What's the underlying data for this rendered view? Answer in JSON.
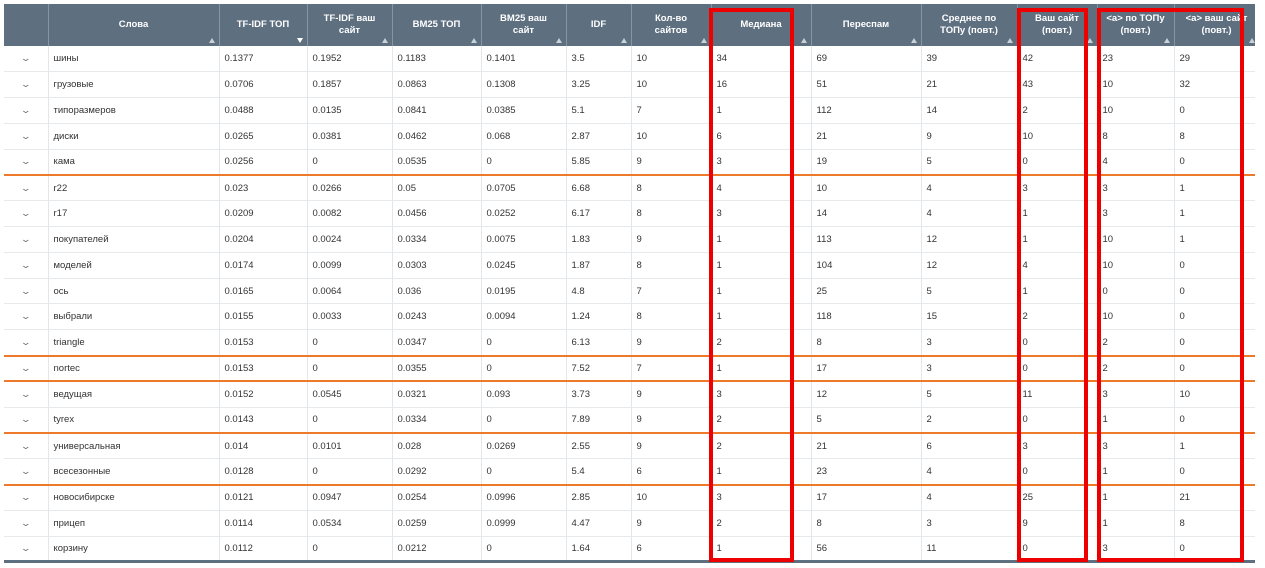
{
  "table": {
    "columns": [
      {
        "label": "",
        "sort": "none"
      },
      {
        "label": "Слова",
        "sort": "asc"
      },
      {
        "label": "TF-IDF ТОП",
        "sort": "desc"
      },
      {
        "label": "TF-IDF ваш сайт",
        "sort": "asc"
      },
      {
        "label": "BM25 ТОП",
        "sort": "asc"
      },
      {
        "label": "BM25 ваш сайт",
        "sort": "asc"
      },
      {
        "label": "IDF",
        "sort": "asc"
      },
      {
        "label": "Кол-во сайтов",
        "sort": "asc"
      },
      {
        "label": "Медиана",
        "sort": "asc"
      },
      {
        "label": "Переспам",
        "sort": "asc"
      },
      {
        "label": "Среднее по ТОПу (повт.)",
        "sort": "asc"
      },
      {
        "label": "Ваш сайт (повт.)",
        "sort": "asc"
      },
      {
        "label": "<a> по ТОПу (повт.)",
        "sort": "asc"
      },
      {
        "label": "<a> ваш сайт (повт.)",
        "sort": "asc"
      }
    ],
    "expand_glyph": "⌄",
    "rows": [
      {
        "cells": [
          "шины",
          "0.1377",
          "0.1952",
          "0.1183",
          "0.1401",
          "3.5",
          "10",
          "34",
          "69",
          "39",
          "42",
          "23",
          "29"
        ],
        "highlight": false
      },
      {
        "cells": [
          "грузовые",
          "0.0706",
          "0.1857",
          "0.0863",
          "0.1308",
          "3.25",
          "10",
          "16",
          "51",
          "21",
          "43",
          "10",
          "32"
        ],
        "highlight": false
      },
      {
        "cells": [
          "типоразмеров",
          "0.0488",
          "0.0135",
          "0.0841",
          "0.0385",
          "5.1",
          "7",
          "1",
          "112",
          "14",
          "2",
          "10",
          "0"
        ],
        "highlight": false
      },
      {
        "cells": [
          "диски",
          "0.0265",
          "0.0381",
          "0.0462",
          "0.068",
          "2.87",
          "10",
          "6",
          "21",
          "9",
          "10",
          "8",
          "8"
        ],
        "highlight": false
      },
      {
        "cells": [
          "кама",
          "0.0256",
          "0",
          "0.0535",
          "0",
          "5.85",
          "9",
          "3",
          "19",
          "5",
          "0",
          "4",
          "0"
        ],
        "highlight": true
      },
      {
        "cells": [
          "r22",
          "0.023",
          "0.0266",
          "0.05",
          "0.0705",
          "6.68",
          "8",
          "4",
          "10",
          "4",
          "3",
          "3",
          "1"
        ],
        "highlight": false
      },
      {
        "cells": [
          "r17",
          "0.0209",
          "0.0082",
          "0.0456",
          "0.0252",
          "6.17",
          "8",
          "3",
          "14",
          "4",
          "1",
          "3",
          "1"
        ],
        "highlight": false
      },
      {
        "cells": [
          "покупателей",
          "0.0204",
          "0.0024",
          "0.0334",
          "0.0075",
          "1.83",
          "9",
          "1",
          "113",
          "12",
          "1",
          "10",
          "1"
        ],
        "highlight": false
      },
      {
        "cells": [
          "моделей",
          "0.0174",
          "0.0099",
          "0.0303",
          "0.0245",
          "1.87",
          "8",
          "1",
          "104",
          "12",
          "4",
          "10",
          "0"
        ],
        "highlight": false
      },
      {
        "cells": [
          "ось",
          "0.0165",
          "0.0064",
          "0.036",
          "0.0195",
          "4.8",
          "7",
          "1",
          "25",
          "5",
          "1",
          "0",
          "0"
        ],
        "highlight": false
      },
      {
        "cells": [
          "выбрали",
          "0.0155",
          "0.0033",
          "0.0243",
          "0.0094",
          "1.24",
          "8",
          "1",
          "118",
          "15",
          "2",
          "10",
          "0"
        ],
        "highlight": false
      },
      {
        "cells": [
          "triangle",
          "0.0153",
          "0",
          "0.0347",
          "0",
          "6.13",
          "9",
          "2",
          "8",
          "3",
          "0",
          "2",
          "0"
        ],
        "highlight": true
      },
      {
        "cells": [
          "nortec",
          "0.0153",
          "0",
          "0.0355",
          "0",
          "7.52",
          "7",
          "1",
          "17",
          "3",
          "0",
          "2",
          "0"
        ],
        "highlight": true
      },
      {
        "cells": [
          "ведущая",
          "0.0152",
          "0.0545",
          "0.0321",
          "0.093",
          "3.73",
          "9",
          "3",
          "12",
          "5",
          "11",
          "3",
          "10"
        ],
        "highlight": false
      },
      {
        "cells": [
          "tyrex",
          "0.0143",
          "0",
          "0.0334",
          "0",
          "7.89",
          "9",
          "2",
          "5",
          "2",
          "0",
          "1",
          "0"
        ],
        "highlight": true
      },
      {
        "cells": [
          "универсальная",
          "0.014",
          "0.0101",
          "0.028",
          "0.0269",
          "2.55",
          "9",
          "2",
          "21",
          "6",
          "3",
          "3",
          "1"
        ],
        "highlight": false
      },
      {
        "cells": [
          "всесезонные",
          "0.0128",
          "0",
          "0.0292",
          "0",
          "5.4",
          "6",
          "1",
          "23",
          "4",
          "0",
          "1",
          "0"
        ],
        "highlight": true
      },
      {
        "cells": [
          "новосибирске",
          "0.0121",
          "0.0947",
          "0.0254",
          "0.0996",
          "2.85",
          "10",
          "3",
          "17",
          "4",
          "25",
          "1",
          "21"
        ],
        "highlight": false
      },
      {
        "cells": [
          "прицеп",
          "0.0114",
          "0.0534",
          "0.0259",
          "0.0999",
          "4.47",
          "9",
          "2",
          "8",
          "3",
          "9",
          "1",
          "8"
        ],
        "highlight": false
      },
      {
        "cells": [
          "корзину",
          "0.0112",
          "0",
          "0.0212",
          "0",
          "1.64",
          "6",
          "1",
          "56",
          "11",
          "0",
          "3",
          "0"
        ],
        "highlight": true
      }
    ]
  },
  "colors": {
    "header_bg": "#5e6f80",
    "highlight_border": "#ed7a2b",
    "annotation_red": "#ee0000"
  }
}
